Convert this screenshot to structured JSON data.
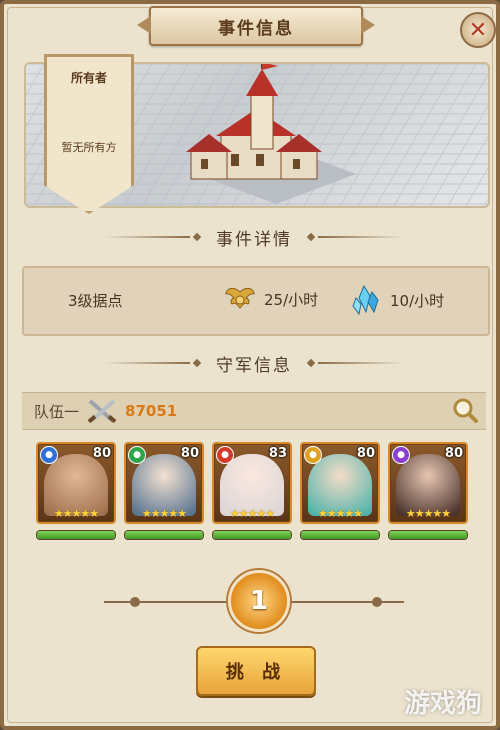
{
  "header": {
    "title": "事件信息",
    "close_glyph": "✕"
  },
  "owner_panel": {
    "label": "所有者",
    "value": "暂无所有方"
  },
  "event_details": {
    "section_title": "事件详情",
    "level_text": "3级据点",
    "rewards": [
      {
        "icon": "wings-icon",
        "value": "25/小时"
      },
      {
        "icon": "crystal-icon",
        "value": "10/小时"
      }
    ]
  },
  "defense": {
    "section_title": "守军信息",
    "team_label": "队伍一",
    "team_power": "87051",
    "heroes": [
      {
        "level": "80",
        "stars": "★★★★★",
        "element_color": "#2f6fd6",
        "portrait": "bald-warrior",
        "hp": 1.0
      },
      {
        "level": "80",
        "stars": "★★★★★",
        "element_color": "#2fa54a",
        "portrait": "horned-armored",
        "hp": 1.0
      },
      {
        "level": "83",
        "stars": "★★★★★",
        "element_color": "#d23a2a",
        "portrait": "white-hair-girl",
        "hp": 1.0
      },
      {
        "level": "80",
        "stars": "★★★★★",
        "element_color": "#e0a020",
        "portrait": "teal-hair-girl",
        "hp": 1.0
      },
      {
        "level": "80",
        "stars": "★★★★★",
        "element_color": "#8a3fd0",
        "portrait": "dark-hair-elf",
        "hp": 1.0
      }
    ]
  },
  "pager": {
    "current": "1"
  },
  "action": {
    "challenge_label": "挑 战"
  },
  "watermark": "游戏狗",
  "colors": {
    "accent": "#d97a17",
    "frame": "#8c6a43",
    "panel": "#ece3cf"
  }
}
